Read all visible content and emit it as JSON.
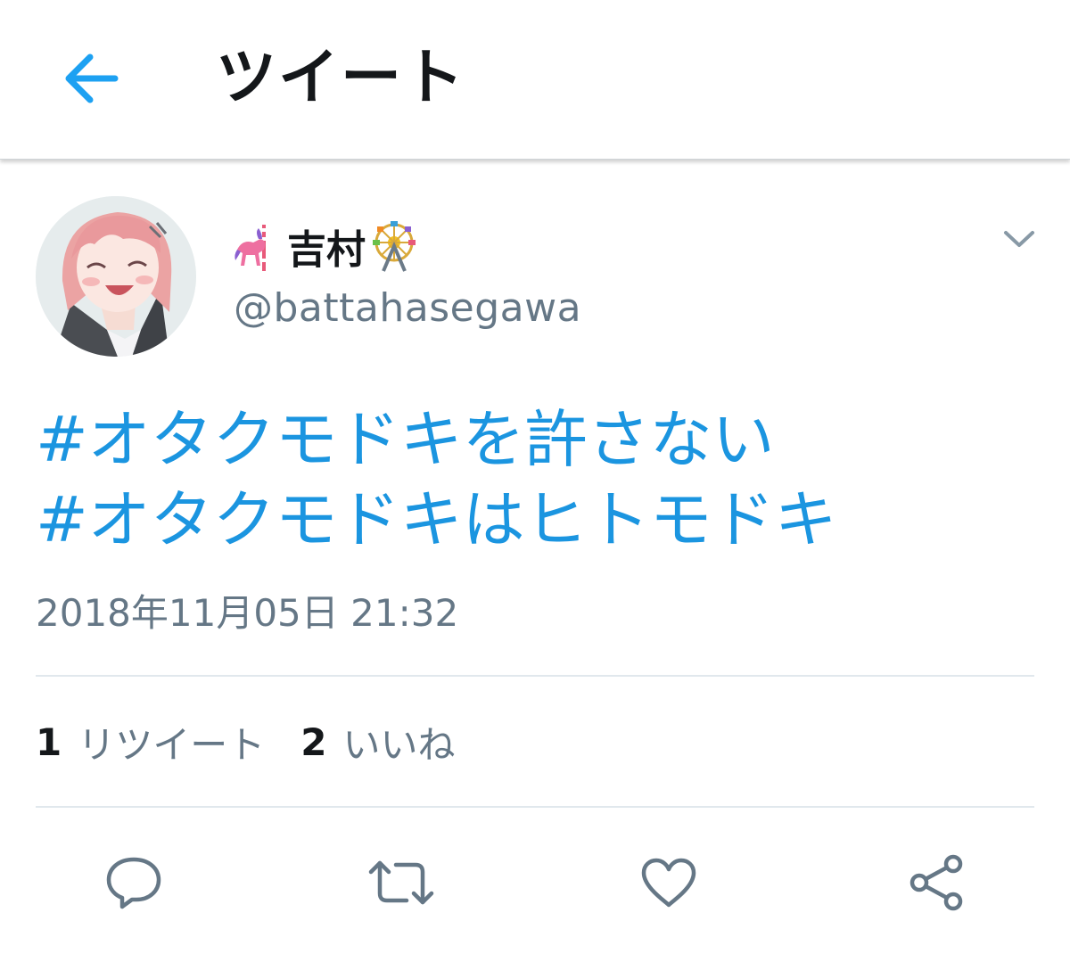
{
  "header": {
    "title": "ツイート",
    "back_icon": "arrow-left-icon",
    "accent_color": "#1da1f2"
  },
  "tweet": {
    "author": {
      "name": "吉村",
      "name_prefix_emoji": "carousel-horse-emoji",
      "name_suffix_emoji": "ferris-wheel-emoji",
      "handle": "@battahasegawa"
    },
    "hashtags": [
      "#オタクモドキを許さない",
      "#オタクモドキはヒトモドキ"
    ],
    "timestamp": "2018年11月05日 21:32",
    "stats": {
      "retweets": {
        "count": "1",
        "label": "リツイート"
      },
      "likes": {
        "count": "2",
        "label": "いいね"
      }
    },
    "actions": [
      "reply-icon",
      "retweet-icon",
      "like-icon",
      "share-icon"
    ],
    "link_color": "#1b95e0",
    "secondary_text_color": "#657786"
  }
}
